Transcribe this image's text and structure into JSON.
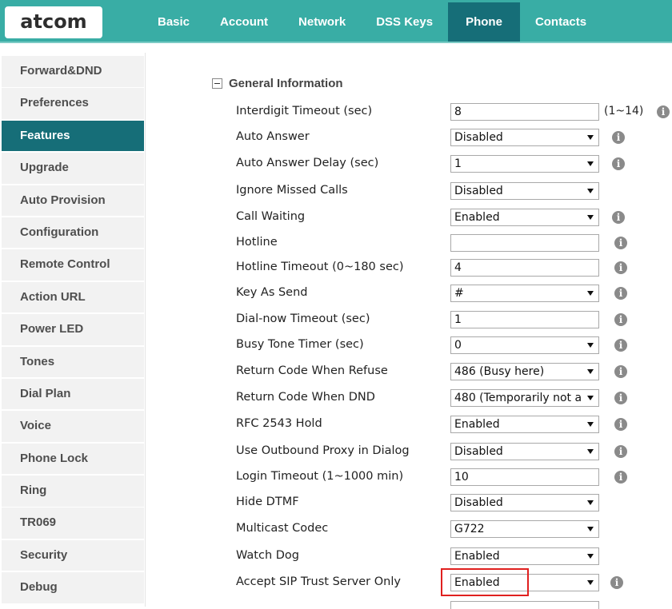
{
  "brand": {
    "logo_text": "atcom"
  },
  "nav": {
    "tabs": [
      {
        "label": "Basic",
        "active": false
      },
      {
        "label": "Account",
        "active": false
      },
      {
        "label": "Network",
        "active": false
      },
      {
        "label": "DSS Keys",
        "active": false
      },
      {
        "label": "Phone",
        "active": true
      },
      {
        "label": "Contacts",
        "active": false
      }
    ]
  },
  "sidebar": {
    "items": [
      {
        "label": "Forward&DND",
        "active": false
      },
      {
        "label": "Preferences",
        "active": false
      },
      {
        "label": "Features",
        "active": true
      },
      {
        "label": "Upgrade",
        "active": false
      },
      {
        "label": "Auto Provision",
        "active": false
      },
      {
        "label": "Configuration",
        "active": false
      },
      {
        "label": "Remote Control",
        "active": false
      },
      {
        "label": "Action URL",
        "active": false
      },
      {
        "label": "Power LED",
        "active": false
      },
      {
        "label": "Tones",
        "active": false
      },
      {
        "label": "Dial Plan",
        "active": false
      },
      {
        "label": "Voice",
        "active": false
      },
      {
        "label": "Phone Lock",
        "active": false
      },
      {
        "label": "Ring",
        "active": false
      },
      {
        "label": "TR069",
        "active": false
      },
      {
        "label": "Security",
        "active": false
      },
      {
        "label": "Debug",
        "active": false
      }
    ]
  },
  "section": {
    "title": "General Information"
  },
  "fields": [
    {
      "label": "Interdigit Timeout (sec)",
      "type": "input",
      "value": "8",
      "hint": "(1~14)",
      "info": true
    },
    {
      "label": "Auto Answer",
      "type": "select",
      "value": "Disabled",
      "info": true
    },
    {
      "label": "Auto Answer Delay (sec)",
      "type": "select",
      "value": "1",
      "info": true
    },
    {
      "label": "Ignore Missed Calls",
      "type": "select",
      "value": "Disabled",
      "info": false
    },
    {
      "label": "Call Waiting",
      "type": "select",
      "value": "Enabled",
      "info": true
    },
    {
      "label": "Hotline",
      "type": "input",
      "value": "",
      "info": true
    },
    {
      "label": "Hotline Timeout (0~180 sec)",
      "type": "input",
      "value": "4",
      "info": true
    },
    {
      "label": "Key As Send",
      "type": "select",
      "value": "#",
      "info": true
    },
    {
      "label": "Dial-now Timeout (sec)",
      "type": "input",
      "value": "1",
      "info": true
    },
    {
      "label": "Busy Tone Timer (sec)",
      "type": "select",
      "value": "0",
      "info": true
    },
    {
      "label": "Return Code When Refuse",
      "type": "select",
      "value": "486 (Busy here)",
      "info": true
    },
    {
      "label": "Return Code When DND",
      "type": "select",
      "value": "480 (Temporarily not a",
      "info": true
    },
    {
      "label": "RFC 2543 Hold",
      "type": "select",
      "value": "Enabled",
      "info": true
    },
    {
      "label": "Use Outbound Proxy in Dialog",
      "type": "select",
      "value": "Disabled",
      "info": true
    },
    {
      "label": "Login Timeout (1~1000 min)",
      "type": "input",
      "value": "10",
      "info": true
    },
    {
      "label": "Hide DTMF",
      "type": "select",
      "value": "Disabled",
      "info": false
    },
    {
      "label": "Multicast Codec",
      "type": "select",
      "value": "G722",
      "info": false
    },
    {
      "label": "Watch Dog",
      "type": "select",
      "value": "Enabled",
      "info": false
    },
    {
      "label": "Accept SIP Trust Server Only",
      "type": "select",
      "value": "Enabled",
      "info": true,
      "highlighted": true
    }
  ],
  "colors": {
    "header": "#39ada5",
    "active": "#166e78",
    "highlight_border": "#e0201f"
  }
}
